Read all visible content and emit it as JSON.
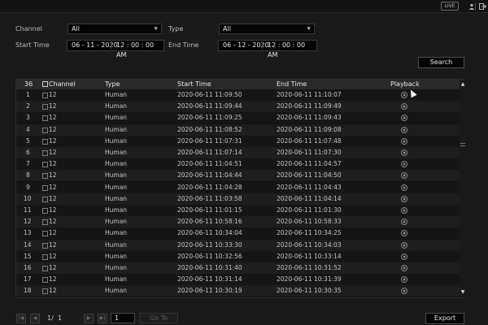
{
  "topbar": {
    "live_label": "LIVE",
    "icons": [
      "user-icon",
      "logout-icon"
    ]
  },
  "filters": {
    "channel_label": "Channel",
    "channel_value": "All",
    "type_label": "Type",
    "type_value": "All",
    "start_label": "Start Time",
    "start_date": "06 - 11 - 2020",
    "start_time": "12 : 00 : 00 AM",
    "end_label": "End Time",
    "end_date": "06 - 12 - 2020",
    "end_time": "12 : 00 : 00 AM"
  },
  "search_label": "Search",
  "table": {
    "count": "36",
    "headers": {
      "channel": "Channel",
      "type": "Type",
      "start": "Start Time",
      "end": "End Time",
      "playback": "Playback"
    },
    "rows": [
      {
        "no": "1",
        "channel": "12",
        "type": "Human",
        "start": "2020-06-11 11:09:50",
        "end": "2020-06-11 11:10:07"
      },
      {
        "no": "2",
        "channel": "12",
        "type": "Human",
        "start": "2020-06-11 11:09:44",
        "end": "2020-06-11 11:09:49"
      },
      {
        "no": "3",
        "channel": "12",
        "type": "Human",
        "start": "2020-06-11 11:09:25",
        "end": "2020-06-11 11:09:43"
      },
      {
        "no": "4",
        "channel": "12",
        "type": "Human",
        "start": "2020-06-11 11:08:52",
        "end": "2020-06-11 11:09:08"
      },
      {
        "no": "5",
        "channel": "12",
        "type": "Human",
        "start": "2020-06-11 11:07:31",
        "end": "2020-06-11 11:07:48"
      },
      {
        "no": "6",
        "channel": "12",
        "type": "Human",
        "start": "2020-06-11 11:07:14",
        "end": "2020-06-11 11:07:30"
      },
      {
        "no": "7",
        "channel": "12",
        "type": "Human",
        "start": "2020-06-11 11:04:51",
        "end": "2020-06-11 11:04:57"
      },
      {
        "no": "8",
        "channel": "12",
        "type": "Human",
        "start": "2020-06-11 11:04:44",
        "end": "2020-06-11 11:04:50"
      },
      {
        "no": "9",
        "channel": "12",
        "type": "Human",
        "start": "2020-06-11 11:04:28",
        "end": "2020-06-11 11:04:43"
      },
      {
        "no": "10",
        "channel": "12",
        "type": "Human",
        "start": "2020-06-11 11:03:58",
        "end": "2020-06-11 11:04:14"
      },
      {
        "no": "11",
        "channel": "12",
        "type": "Human",
        "start": "2020-06-11 11:01:15",
        "end": "2020-06-11 11:01:30"
      },
      {
        "no": "12",
        "channel": "12",
        "type": "Human",
        "start": "2020-06-11 10:58:16",
        "end": "2020-06-11 10:58:33"
      },
      {
        "no": "13",
        "channel": "12",
        "type": "Human",
        "start": "2020-06-11 10:34:04",
        "end": "2020-06-11 10:34:25"
      },
      {
        "no": "14",
        "channel": "12",
        "type": "Human",
        "start": "2020-06-11 10:33:30",
        "end": "2020-06-11 10:34:03"
      },
      {
        "no": "15",
        "channel": "12",
        "type": "Human",
        "start": "2020-06-11 10:32:56",
        "end": "2020-06-11 10:33:14"
      },
      {
        "no": "16",
        "channel": "12",
        "type": "Human",
        "start": "2020-06-11 10:31:40",
        "end": "2020-06-11 10:31:52"
      },
      {
        "no": "17",
        "channel": "12",
        "type": "Human",
        "start": "2020-06-11 10:31:14",
        "end": "2020-06-11 10:31:39"
      },
      {
        "no": "18",
        "channel": "12",
        "type": "Human",
        "start": "2020-06-11 10:30:19",
        "end": "2020-06-11 10:30:35"
      }
    ]
  },
  "pagination": {
    "current": "1/",
    "total": "1",
    "page_input": "1",
    "goto_label": "Go To"
  },
  "export_label": "Export"
}
